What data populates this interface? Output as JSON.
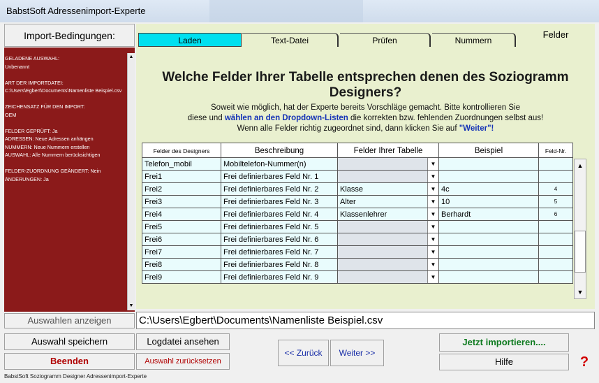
{
  "window": {
    "title": "BabstSoft Adressenimport-Experte"
  },
  "left": {
    "header": "Import-Bedingungen:",
    "text": "GELADENE AUSWAHL:\nUnbenannt\n\nART DER IMPORTDATEI:\nC:\\Users\\Egbert\\Documents\\Namenliste Beispiel.csv\n\nZEICHENSATZ FÜR DEN IMPORT:\nOEM\n\nFELDER GEPRÜFT: Ja\nADRESSEN: Neue Adressen anhängen\nNUMMERN: Neue Nummern erstellen\nAUSWAHL: Alle Nummern berücksichtigen\n\nFELDER-ZUORDNUNG GEÄNDERT: Nein\nÄNDERUNGEN: Ja"
  },
  "tabs": [
    "Laden",
    "Text-Datei",
    "Prüfen",
    "Nummern",
    "Felder"
  ],
  "heading": "Welche Felder Ihrer Tabelle entsprechen denen des Soziogramm Designers?",
  "instructions": {
    "line1": "Soweit wie möglich, hat der Experte bereits Vorschläge gemacht. Bitte kontrollieren Sie",
    "line2a": "diese und ",
    "line2b": "wählen an den Dropdown-Listen",
    "line2c": " die korrekten bzw. fehlenden Zuordnungen selbst aus!",
    "line3a": "Wenn alle Felder richtig zugeordnet sind, dann klicken Sie auf ",
    "line3b": "\"Weiter\"!"
  },
  "grid": {
    "headers": [
      "Felder des Designers",
      "Beschreibung",
      "Felder Ihrer Tabelle",
      "Beispiel",
      "Feld-Nr."
    ],
    "rows": [
      [
        "Telefon_mobil",
        "Mobiltelefon-Nummer(n)",
        "",
        "",
        ""
      ],
      [
        "Frei1",
        "Frei definierbares Feld Nr. 1",
        "",
        "",
        ""
      ],
      [
        "Frei2",
        "Frei definierbares Feld Nr. 2",
        "Klasse",
        "4c",
        "4"
      ],
      [
        "Frei3",
        "Frei definierbares Feld Nr. 3",
        "Alter",
        "10",
        "5"
      ],
      [
        "Frei4",
        "Frei definierbares Feld Nr. 4",
        "Klassenlehrer",
        "Berhardt",
        "6"
      ],
      [
        "Frei5",
        "Frei definierbares Feld Nr. 5",
        "",
        "",
        ""
      ],
      [
        "Frei6",
        "Frei definierbares Feld Nr. 6",
        "",
        "",
        ""
      ],
      [
        "Frei7",
        "Frei definierbares Feld Nr. 7",
        "",
        "",
        ""
      ],
      [
        "Frei8",
        "Frei definierbares Feld Nr. 8",
        "",
        "",
        ""
      ],
      [
        "Frei9",
        "Frei definierbares Feld Nr. 9",
        "",
        "",
        ""
      ]
    ]
  },
  "path": "C:\\Users\\Egbert\\Documents\\Namenliste Beispiel.csv",
  "buttons": {
    "show_selection": "Auswahlen anzeigen",
    "save_selection": "Auswahl speichern",
    "exit": "Beenden",
    "view_log": "Logdatei ansehen",
    "reset_selection": "Auswahl zurücksetzen",
    "back": "<< Zurück",
    "next": "Weiter >>",
    "import_now": "Jetzt importieren....",
    "help": "Hilfe",
    "question": "?"
  },
  "status": "BabstSoft Soziogramm Designer Adressenimport-Experte",
  "colors": {
    "left_panel": "#8b1a1a",
    "main_bg": "#e9f0cf",
    "active_tab": "#00e0ef",
    "cell_bg": "#e9fcfd"
  }
}
